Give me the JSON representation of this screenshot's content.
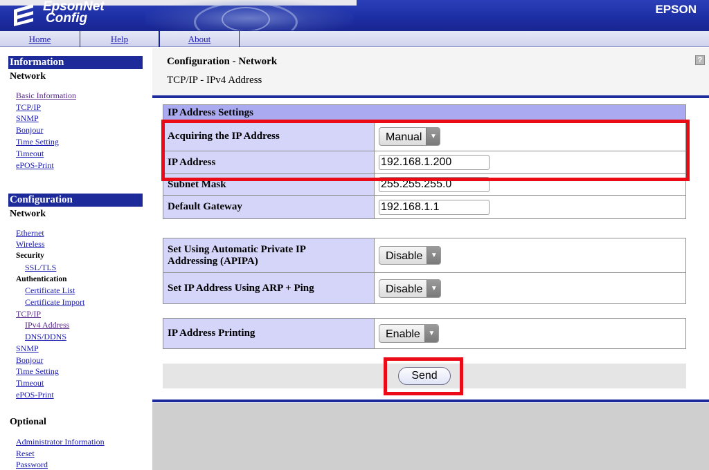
{
  "colors": {
    "accent": "#1c2a9a",
    "label_bg": "#d4d5f9",
    "header_bg": "#a9aaef",
    "highlight": "#ea0b16"
  },
  "header": {
    "logo_line1": "EpsonNet",
    "logo_line2": "Config",
    "brand": "EPSON",
    "logo_icon": "epsonnet-logo-icon"
  },
  "topnav": {
    "home": "Home",
    "help": "Help",
    "about": "About"
  },
  "sidebar": {
    "information": {
      "title": "Information",
      "subtitle": "Network",
      "items": [
        "Basic Information",
        "TCP/IP",
        "SNMP",
        "Bonjour",
        "Time Setting",
        "Timeout",
        "ePOS-Print"
      ]
    },
    "configuration": {
      "title": "Configuration",
      "subtitle": "Network",
      "ethernet": "Ethernet",
      "wireless": "Wireless",
      "security": "Security",
      "ssl": "SSL/TLS",
      "authentication": "Authentication",
      "cert_list": "Certificate List",
      "cert_import": "Certificate Import",
      "tcpip": "TCP/IP",
      "ipv4": "IPv4 Address",
      "dns": "DNS/DDNS",
      "snmp": "SNMP",
      "bonjour": "Bonjour",
      "time_setting": "Time Setting",
      "timeout": "Timeout",
      "epos": "ePOS-Print"
    },
    "optional": {
      "title": "Optional",
      "items": [
        "Administrator Information",
        "Reset",
        "Password"
      ]
    }
  },
  "main": {
    "title": "Configuration - Network",
    "subtitle": "TCP/IP - IPv4 Address",
    "help_icon": "?",
    "section_header": "IP Address Settings",
    "rows": {
      "acquiring_label": "Acquiring the IP Address",
      "acquiring_value": "Manual",
      "ip_label": "IP Address",
      "ip_value": "192.168.1.200",
      "subnet_label": "Subnet Mask",
      "subnet_value": "255.255.255.0",
      "gateway_label": "Default Gateway",
      "gateway_value": "192.168.1.1",
      "apipa_label_1": "Set Using Automatic Private IP",
      "apipa_label_2": "Addressing (APIPA)",
      "apipa_value": "Disable",
      "arp_label": "Set IP Address Using ARP + Ping",
      "arp_value": "Disable",
      "printing_label": "IP Address Printing",
      "printing_value": "Enable"
    },
    "send": "Send"
  }
}
